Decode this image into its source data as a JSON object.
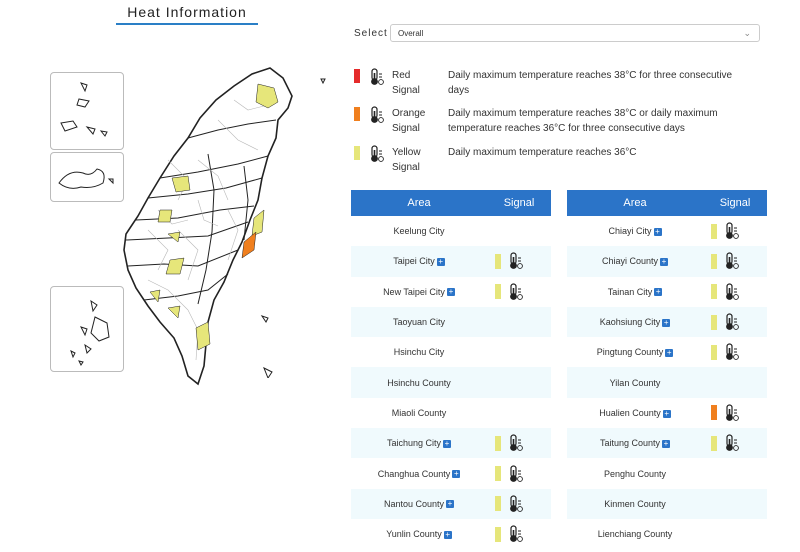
{
  "header": {
    "title": "Heat Information"
  },
  "filter": {
    "label": "Select",
    "value": "Overall",
    "chevron_icon": "chevron-down-icon"
  },
  "colors": {
    "red": "#e52b2b",
    "orange": "#f07f1e",
    "yellow": "#e6e67a",
    "header_blue": "#2b74c8",
    "row_alt": "#f0fafd"
  },
  "legend": [
    {
      "name": "Red\nSignal",
      "color": "#e52b2b",
      "icon": "thermometer-icon",
      "description": "Daily maximum temperature reaches 38°C for three consecutive days"
    },
    {
      "name": "Orange\nSignal",
      "color": "#f07f1e",
      "icon": "thermometer-icon",
      "description": "Daily maximum temperature reaches 38°C or daily maximum temperature reaches 36°C for three consecutive days"
    },
    {
      "name": "Yellow\nSignal",
      "color": "#e6e67a",
      "icon": "thermometer-icon",
      "description": "Daily maximum temperature reaches 36°C"
    }
  ],
  "tables": [
    {
      "headers": {
        "area": "Area",
        "signal": "Signal"
      },
      "rows": [
        {
          "area": "Keelung City",
          "expandable": false,
          "signal": ""
        },
        {
          "area": "Taipei City",
          "expandable": true,
          "signal": "yellow"
        },
        {
          "area": "New Taipei City",
          "expandable": true,
          "signal": "yellow"
        },
        {
          "area": "Taoyuan City",
          "expandable": false,
          "signal": ""
        },
        {
          "area": "Hsinchu City",
          "expandable": false,
          "signal": ""
        },
        {
          "area": "Hsinchu County",
          "expandable": false,
          "signal": ""
        },
        {
          "area": "Miaoli County",
          "expandable": false,
          "signal": ""
        },
        {
          "area": "Taichung City",
          "expandable": true,
          "signal": "yellow"
        },
        {
          "area": "Changhua County",
          "expandable": true,
          "signal": "yellow"
        },
        {
          "area": "Nantou County",
          "expandable": true,
          "signal": "yellow"
        },
        {
          "area": "Yunlin County",
          "expandable": true,
          "signal": "yellow"
        }
      ]
    },
    {
      "headers": {
        "area": "Area",
        "signal": "Signal"
      },
      "rows": [
        {
          "area": "Chiayi City",
          "expandable": true,
          "signal": "yellow"
        },
        {
          "area": "Chiayi County",
          "expandable": true,
          "signal": "yellow"
        },
        {
          "area": "Tainan City",
          "expandable": true,
          "signal": "yellow"
        },
        {
          "area": "Kaohsiung City",
          "expandable": true,
          "signal": "yellow"
        },
        {
          "area": "Pingtung County",
          "expandable": true,
          "signal": "yellow"
        },
        {
          "area": "Yilan County",
          "expandable": false,
          "signal": ""
        },
        {
          "area": "Hualien County",
          "expandable": true,
          "signal": "orange"
        },
        {
          "area": "Taitung County",
          "expandable": true,
          "signal": "yellow"
        },
        {
          "area": "Penghu County",
          "expandable": false,
          "signal": ""
        },
        {
          "area": "Kinmen County",
          "expandable": false,
          "signal": ""
        },
        {
          "area": "Lienchiang County",
          "expandable": false,
          "signal": ""
        }
      ]
    }
  ]
}
